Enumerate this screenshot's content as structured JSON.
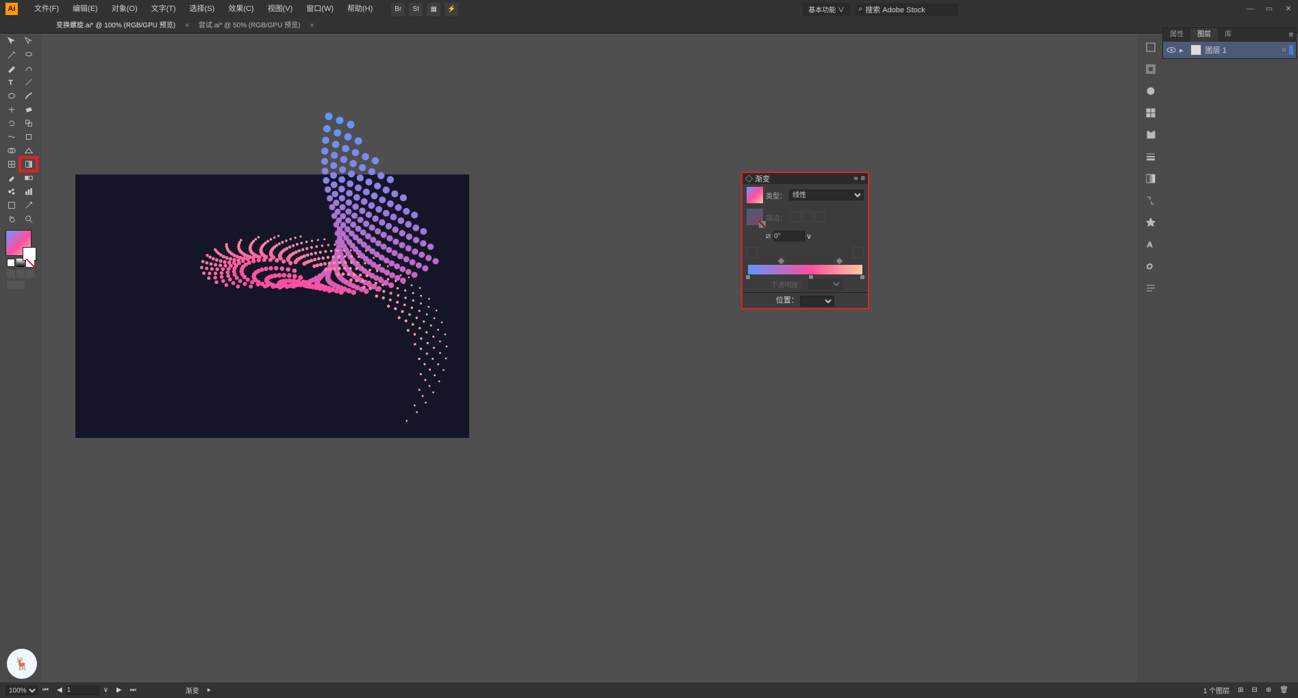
{
  "menu": {
    "items": [
      "文件(F)",
      "编辑(E)",
      "对象(O)",
      "文字(T)",
      "选择(S)",
      "效果(C)",
      "视图(V)",
      "窗口(W)",
      "帮助(H)"
    ],
    "top_icons": [
      "Br",
      "St"
    ],
    "workspace": "基本功能 ∨",
    "search_placeholder": "搜索 Adobe Stock"
  },
  "tabs": [
    {
      "label": "变换螺旋.ai* @ 100% (RGB/GPU 预览)",
      "active": true
    },
    {
      "label": "尝试.ai* @ 50% (RGB/GPU 预览)",
      "active": false
    }
  ],
  "gradient_panel": {
    "title": "◇ 渐变",
    "type_label": "类型：",
    "type_value": "线性",
    "stroke_label": "描边：",
    "angle_value": "0°",
    "opacity_label": "不透明度：",
    "position_label": "位置：",
    "stops": [
      0,
      55,
      100
    ],
    "diamonds": [
      27,
      78
    ]
  },
  "layers": {
    "tabs": [
      "属性",
      "图层",
      "库"
    ],
    "active_tab": 1,
    "row_name": "图层 1",
    "footer": "1 个图层"
  },
  "status": {
    "zoom": "100%",
    "page": "1",
    "tool": "渐变"
  },
  "colors": {
    "grad_start": "#6195ff",
    "grad_mid": "#ff4d9e",
    "grad_end": "#ffc8a6",
    "highlight_red": "#e62020"
  }
}
